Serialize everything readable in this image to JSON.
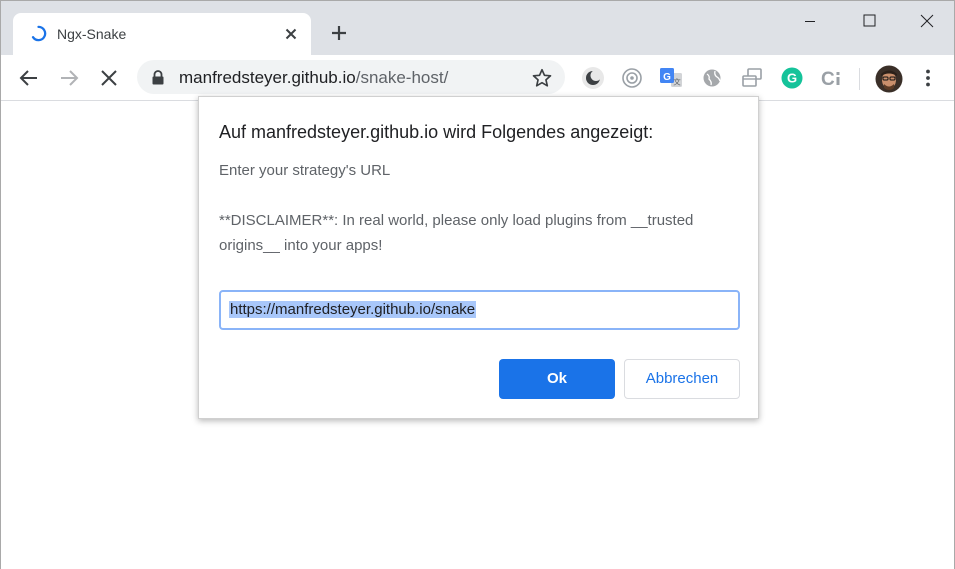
{
  "browser": {
    "tab": {
      "title": "Ngx-Snake",
      "loading": true
    },
    "address_bar": {
      "host": "manfredsteyer.github.io",
      "path": "/snake-host/"
    },
    "extensions": [
      "dark-mode-icon",
      "radar-icon",
      "google-translate-icon",
      "globe-icon",
      "window-icon",
      "grammarly-icon",
      "ci-icon"
    ],
    "accent_color": "#1a73e8"
  },
  "dialog": {
    "title": "Auf manfredsteyer.github.io wird Folgendes angezeigt:",
    "message": "Enter your strategy's URL\n\n**DISCLAIMER**: In real world, please only load plugins from __trusted origins__ into your apps!",
    "input_value": "https://manfredsteyer.github.io/snake",
    "ok_label": "Ok",
    "cancel_label": "Abbrechen"
  }
}
